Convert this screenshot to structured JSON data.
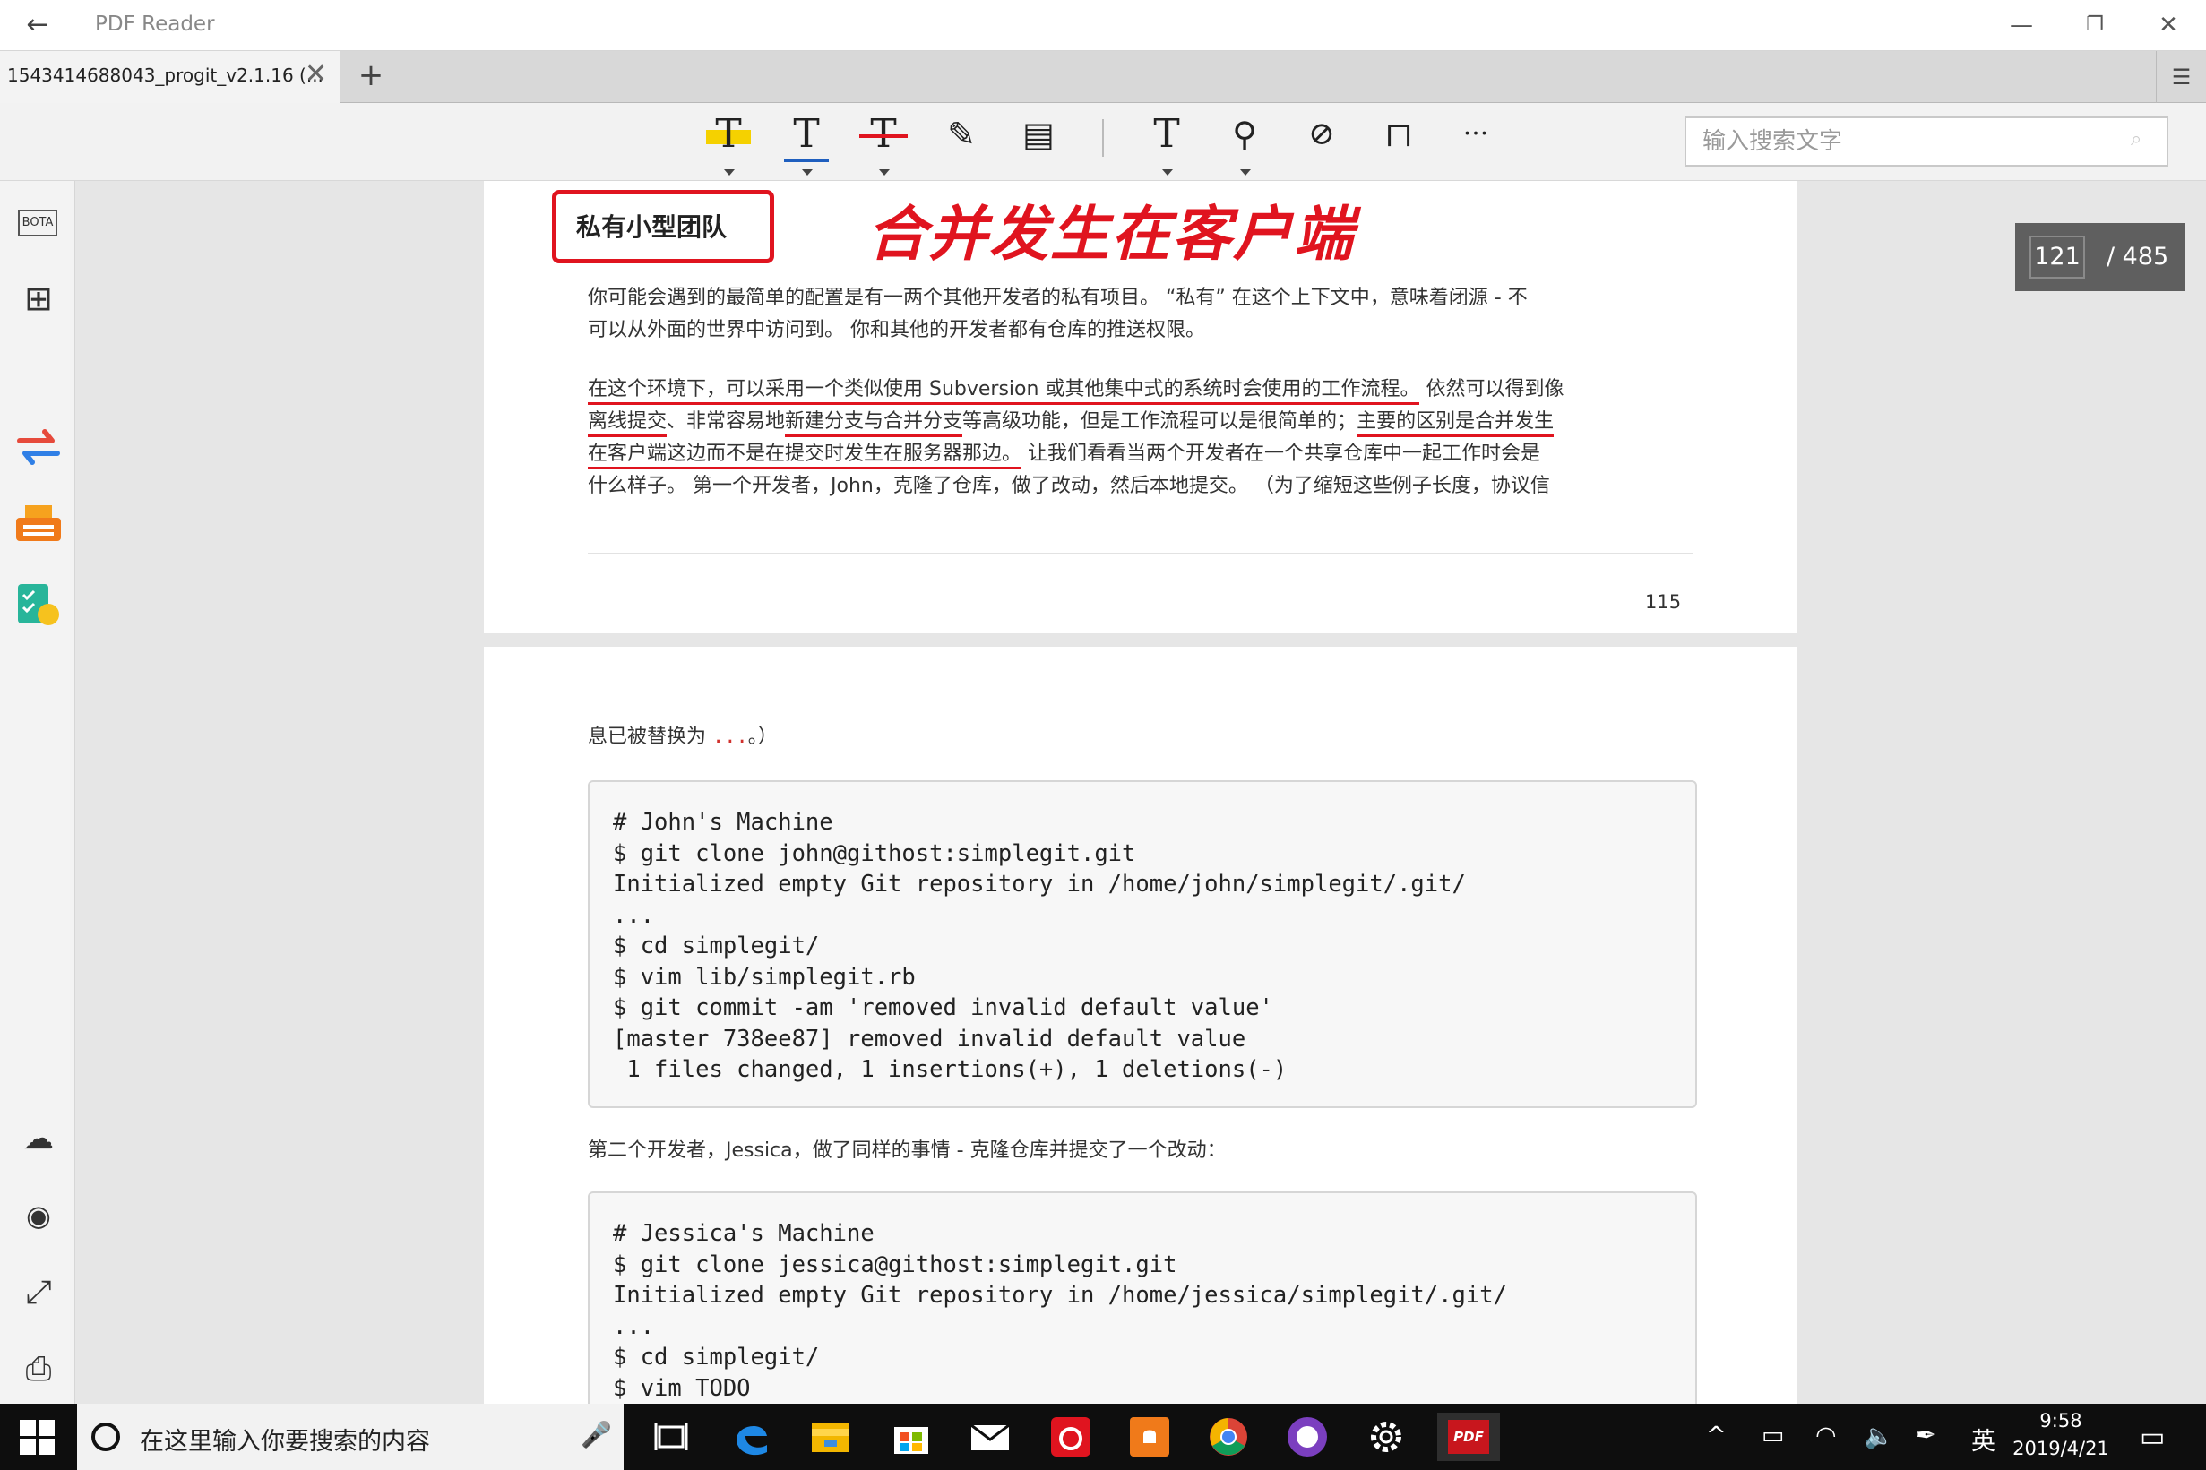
{
  "window": {
    "title": "PDF Reader",
    "back_glyph": "←",
    "min_glyph": "—",
    "max_glyph": "❐",
    "close_glyph": "✕"
  },
  "tabs": {
    "active_label": "1543414688043_progit_v2.1.16 (...",
    "close_glyph": "✕",
    "new_tab_glyph": "+",
    "menu_glyph": "☰"
  },
  "toolbar": {
    "tools": [
      {
        "name": "highlight-text-tool",
        "glyph": "T",
        "accent": "#f5d100"
      },
      {
        "name": "underline-text-tool",
        "glyph": "T",
        "accent": "#1f5fbf"
      },
      {
        "name": "strikethrough-text-tool",
        "glyph": "T",
        "accent": "#e0141f"
      },
      {
        "name": "pen-tool",
        "glyph": "✎"
      },
      {
        "name": "note-tool",
        "glyph": "▤"
      },
      {
        "name": "text-tool",
        "glyph": "T"
      },
      {
        "name": "stamp-tool",
        "glyph": "⚲"
      },
      {
        "name": "link-tool",
        "glyph": "⊘"
      },
      {
        "name": "bookmark-tool",
        "glyph": "⊓"
      },
      {
        "name": "more-tool",
        "glyph": "···"
      }
    ],
    "search_placeholder": "输入搜索文字"
  },
  "sidebar": {
    "bota_label": "BOTA",
    "grid_glyph": "⊞",
    "bottom_icons": [
      "☁",
      "◉",
      "⤢",
      "⎙"
    ]
  },
  "document": {
    "page1": {
      "heading": "私有小型团队",
      "handwritten_note": "合并发生在客户端",
      "para1_line1": "你可能会遇到的最简单的配置是有一两个其他开发者的私有项目。 “私有” 在这个上下文中，意味着闭源 - 不",
      "para1_line2": "可以从外面的世界中访问到。 你和其他的开发者都有仓库的推送权限。",
      "para2_line1_ul": "在这个环境下，可以采用一个类似使用 Subversion 或其他集中式的系统时会使用的工作流程。",
      "para2_line1_rest": " 依然可以得到像",
      "para2_line2_ul1": "离线提交",
      "para2_line2_a": "、非常容易地",
      "para2_line2_ul2": "新建分支与合并分支",
      "para2_line2_b": "等高级功能，但是工作流程可以是很简单的；",
      "para2_line2_ul3": "主要的区别是合并发生",
      "para2_line3_ul": "在客户端这边而不是在提交时发生在服务器那边。",
      "para2_line3_rest": " 让我们看看当两个开发者在一个共享仓库中一起工作时会是",
      "para2_line4": "什么样子。 第一个开发者，John，克隆了仓库，做了改动，然后本地提交。 （为了缩短这些例子长度，协议信",
      "page_number": "115"
    },
    "page2": {
      "intro_text": "息已被替换为 ",
      "intro_dots": "...",
      "intro_end": "。）",
      "code1": [
        "# John's Machine",
        "$ git clone john@githost:simplegit.git",
        "Initialized empty Git repository in /home/john/simplegit/.git/",
        "...",
        "$ cd simplegit/",
        "$ vim lib/simplegit.rb",
        "$ git commit -am 'removed invalid default value'",
        "[master 738ee87] removed invalid default value",
        " 1 files changed, 1 insertions(+), 1 deletions(-)"
      ],
      "para2": "第二个开发者，Jessica，做了同样的事情 - 克隆仓库并提交了一个改动：",
      "code2": [
        "# Jessica's Machine",
        "$ git clone jessica@githost:simplegit.git",
        "Initialized empty Git repository in /home/jessica/simplegit/.git/",
        "...",
        "$ cd simplegit/",
        "$ vim TODO"
      ]
    }
  },
  "page_indicator": {
    "current": "121",
    "total": "/ 485"
  },
  "taskbar": {
    "search_placeholder": "在这里输入你要搜索的内容",
    "mic_glyph": "🎤",
    "apps": [
      {
        "name": "task-view-icon",
        "color": "#0e0e0e"
      },
      {
        "name": "edge-icon",
        "color": "#1e88e5"
      },
      {
        "name": "file-explorer-icon",
        "color": "#f2b600"
      },
      {
        "name": "store-icon",
        "color": "#ffffff"
      },
      {
        "name": "mail-icon",
        "color": "#ffffff"
      },
      {
        "name": "netease-music-icon",
        "color": "#e0141f"
      },
      {
        "name": "notification-app-icon",
        "color": "#f07a1a"
      },
      {
        "name": "chrome-icon",
        "color": "#34a853"
      },
      {
        "name": "github-icon",
        "color": "#7b3fbf"
      },
      {
        "name": "settings-icon",
        "color": "#0e0e0e"
      },
      {
        "name": "pdf-reader-icon",
        "color": "#c8161d"
      }
    ],
    "pdf_label": "PDF",
    "tray": {
      "chevron": "^",
      "battery": "▭",
      "wifi": "◠",
      "volume": "🔈",
      "pen": "✒",
      "ime": "英"
    },
    "time": "9:58",
    "date": "2019/4/21",
    "notification_glyph": "▭"
  }
}
